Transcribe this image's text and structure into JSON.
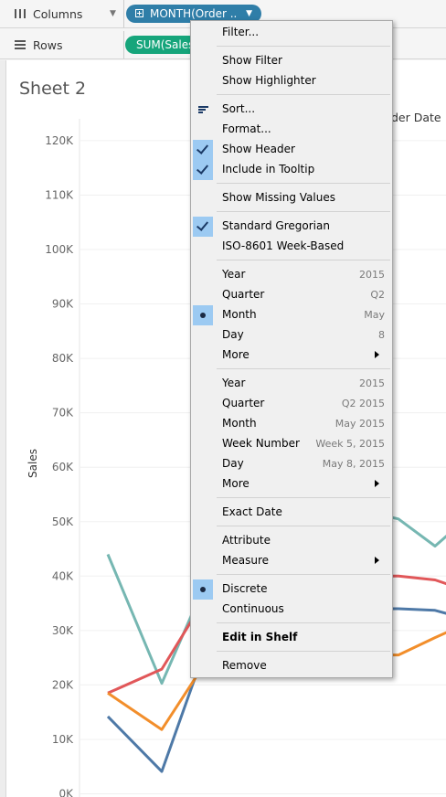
{
  "shelves": {
    "columns": {
      "label": "Columns",
      "pill": "MONTH(Order .."
    },
    "rows": {
      "label": "Rows",
      "pill": "SUM(Sales"
    }
  },
  "sheet": {
    "title": "Sheet 2",
    "legend_fragment": "der Date"
  },
  "chart_data": {
    "type": "line",
    "ylabel": "Sales",
    "ylim": [
      0,
      125000
    ],
    "yticks": [
      "120K",
      "110K",
      "100K",
      "90K",
      "80K",
      "70K",
      "60K",
      "50K",
      "40K",
      "30K",
      "20K",
      "10K",
      "0K"
    ],
    "series": [
      {
        "color": "#76b7b2",
        "values": [
          44000,
          20300,
          43000,
          50000,
          52000,
          52000,
          50500,
          45500,
          52000
        ]
      },
      {
        "color": "#e15759",
        "values": [
          18500,
          22900,
          39000,
          40000,
          40000,
          40000,
          40000,
          39300,
          36800
        ]
      },
      {
        "color": "#4e79a7",
        "values": [
          14200,
          4100,
          32000,
          34000,
          34000,
          34000,
          34000,
          33700,
          31700
        ]
      },
      {
        "color": "#f28e2b",
        "values": [
          18500,
          11800,
          27000,
          26000,
          25500,
          25500,
          25500,
          28700,
          32000
        ]
      }
    ]
  },
  "menu": {
    "items": [
      {
        "label": "Filter..."
      },
      {
        "label": "Show Filter"
      },
      {
        "label": "Show Highlighter"
      },
      {
        "label": "Sort...",
        "icon": "sort-icon"
      },
      {
        "label": "Format..."
      },
      {
        "label": "Show Header",
        "state": "checked"
      },
      {
        "label": "Include in Tooltip",
        "state": "checked"
      },
      {
        "label": "Show Missing Values"
      },
      {
        "label": "Standard Gregorian",
        "state": "checked"
      },
      {
        "label": "ISO-8601 Week-Based"
      },
      {
        "label": "Year",
        "right": "2015"
      },
      {
        "label": "Quarter",
        "right": "Q2"
      },
      {
        "label": "Month",
        "right": "May",
        "state": "selected"
      },
      {
        "label": "Day",
        "right": "8"
      },
      {
        "label": "More",
        "submenu": true
      },
      {
        "label": "Year",
        "right": "2015"
      },
      {
        "label": "Quarter",
        "right": "Q2 2015"
      },
      {
        "label": "Month",
        "right": "May 2015"
      },
      {
        "label": "Week Number",
        "right": "Week 5, 2015"
      },
      {
        "label": "Day",
        "right": "May 8, 2015"
      },
      {
        "label": "More",
        "submenu": true
      },
      {
        "label": "Exact Date"
      },
      {
        "label": "Attribute"
      },
      {
        "label": "Measure",
        "submenu": true
      },
      {
        "label": "Discrete",
        "state": "selected"
      },
      {
        "label": "Continuous"
      },
      {
        "label": "Edit in Shelf",
        "bold": true
      },
      {
        "label": "Remove"
      }
    ]
  }
}
